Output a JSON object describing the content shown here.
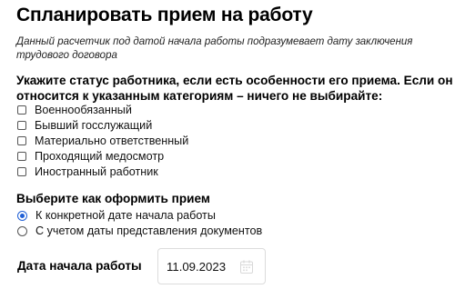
{
  "page": {
    "title": "Спланировать прием на работу",
    "note": "Данный расчетчик под датой начала работы подразумевает дату заключения трудового договора"
  },
  "employee_status": {
    "title_line1": "Укажите статус работника, если есть особенности его приема. Если он не",
    "title_line2": "относится к указанным категориям – ничего не выбирайте:",
    "options": [
      {
        "label": "Военнообязанный",
        "checked": false
      },
      {
        "label": "Бывший госслужащий",
        "checked": false
      },
      {
        "label": "Материально ответственный",
        "checked": false
      },
      {
        "label": "Проходящий медосмотр",
        "checked": false
      },
      {
        "label": "Иностранный работник",
        "checked": false
      }
    ]
  },
  "hiring_mode": {
    "title": "Выберите как оформить прием",
    "options": [
      {
        "label": "К конкретной дате начала работы",
        "selected": true
      },
      {
        "label": "С учетом даты представления документов",
        "selected": false
      }
    ]
  },
  "start_date": {
    "label": "Дата начала работы",
    "value": "11.09.2023",
    "icon": "calendar-icon"
  },
  "colors": {
    "accent": "#1f5fd6",
    "text": "#000000",
    "border": "#dcdcdc"
  }
}
